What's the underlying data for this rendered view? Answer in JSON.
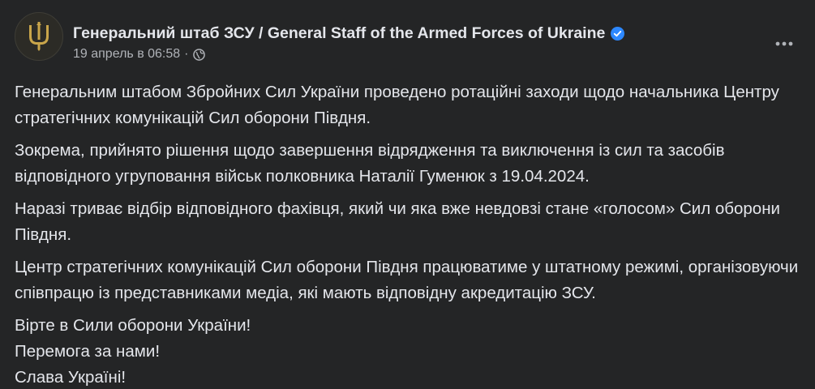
{
  "post": {
    "author": "Генеральний штаб ЗСУ / General Staff of the Armed Forces of Ukraine",
    "timestamp": "19 апрель в 06:58",
    "separator": "·",
    "verified_icon": "verified-badge-icon",
    "audience_icon": "globe-icon",
    "more_icon": "more-options-icon",
    "avatar_icon": "tryzub-emblem",
    "accent_color": "#2d88ff",
    "paragraphs": [
      "Генеральним штабом Збройних Сил України проведено ротаційні заходи щодо начальника Центру стратегічних комунікацій Сил оборони Півдня.",
      "Зокрема, прийнято рішення щодо завершення відрядження та виключення із сил та засобів відповідного угруповання військ полковника Наталії Гуменюк з 19.04.2024.",
      "Наразі триває відбір відповідного фахівця, який чи яка вже невдовзі стане «голосом» Сил оборони Півдня.",
      "Центр стратегічних комунікацій Сил оборони Півдня працюватиме у штатному режимі, організовуючи співпрацю із представниками медіа, які мають відповідну акредитацію ЗСУ."
    ],
    "closing_lines": [
      "Вірте в Сили оборони України!",
      "Перемога за нами!",
      "Слава Україні!"
    ]
  }
}
